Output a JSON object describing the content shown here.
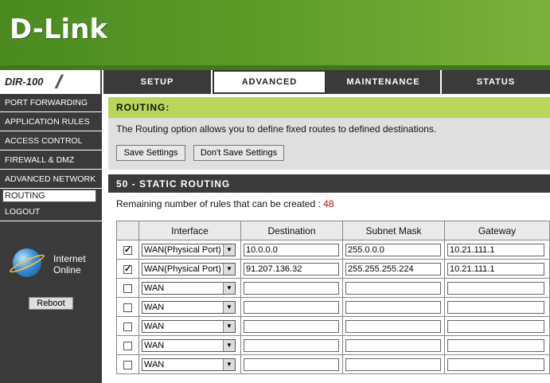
{
  "brand": {
    "logo": "D-Link",
    "model": "DIR-100"
  },
  "tabs": [
    {
      "label": "SETUP"
    },
    {
      "label": "ADVANCED"
    },
    {
      "label": "MAINTENANCE"
    },
    {
      "label": "STATUS"
    }
  ],
  "sidebar": {
    "items": [
      {
        "label": "Port Forwarding"
      },
      {
        "label": "Application Rules"
      },
      {
        "label": "Access Control"
      },
      {
        "label": "Firewall & DMZ"
      },
      {
        "label": "Advanced Network"
      },
      {
        "label": "Routing"
      },
      {
        "label": "Logout"
      }
    ],
    "internet_line1": "Internet",
    "internet_line2": "Online",
    "reboot_label": "Reboot"
  },
  "routing": {
    "title": "ROUTING:",
    "description": "The Routing option allows you to define fixed routes to defined destinations.",
    "save_label": "Save Settings",
    "dont_save_label": "Don't Save Settings"
  },
  "static": {
    "title": "50 - STATIC ROUTING",
    "remaining_label": "Remaining number of rules that can be created : ",
    "remaining_count": "48",
    "headers": [
      "Interface",
      "Destination",
      "Subnet Mask",
      "Gateway"
    ],
    "rows": [
      {
        "checked": true,
        "interface": "WAN(Physical Port)",
        "destination": "10.0.0.0",
        "mask": "255.0.0.0",
        "gateway": "10.21.111.1"
      },
      {
        "checked": true,
        "interface": "WAN(Physical Port)",
        "destination": "91.207.136.32",
        "mask": "255.255.255.224",
        "gateway": "10.21.111.1"
      },
      {
        "checked": false,
        "interface": "WAN",
        "destination": "",
        "mask": "",
        "gateway": ""
      },
      {
        "checked": false,
        "interface": "WAN",
        "destination": "",
        "mask": "",
        "gateway": ""
      },
      {
        "checked": false,
        "interface": "WAN",
        "destination": "",
        "mask": "",
        "gateway": ""
      },
      {
        "checked": false,
        "interface": "WAN",
        "destination": "",
        "mask": "",
        "gateway": ""
      },
      {
        "checked": false,
        "interface": "WAN",
        "destination": "",
        "mask": "",
        "gateway": ""
      }
    ]
  },
  "colors": {
    "banner": "#5c9a27",
    "section_head": "#b8d65a",
    "dark": "#3a3a3a",
    "count": "#bb1111"
  }
}
